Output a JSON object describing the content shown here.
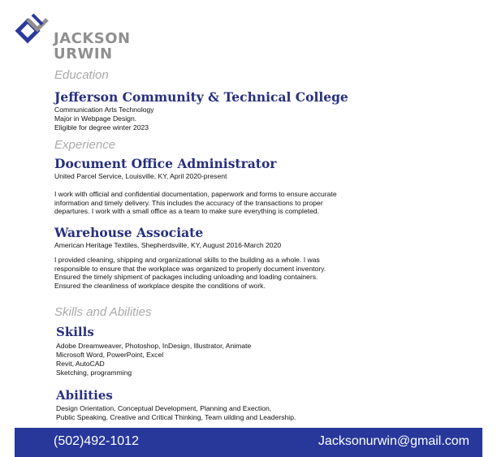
{
  "brand": {
    "line1": "JACKSON",
    "line2": "URWIN"
  },
  "education": {
    "label": "Education",
    "school": "Jefferson Community & Technical College",
    "lines": [
      "Communication Arts Technology",
      "Major in Webpage Design.",
      "Eligible for degree winter 2023"
    ]
  },
  "experience": {
    "label": "Experience",
    "jobs": [
      {
        "title": "Document Office Administrator",
        "subtitle": "United Parcel Service, Louisville, KY, April 2020-present",
        "lines": [
          "I work with official and confidential documentation, paperwork and forms to ensure accurate",
          "information and timely delivery. This includes the accuracy of the transactions to proper",
          "departures. I work with a small office as a team to make sure everything is completed."
        ]
      },
      {
        "title": "Warehouse Associate",
        "subtitle": "American Heritage Textiles, Shepherdsville, KY,  August 2016-March 2020",
        "lines": [
          "I provided cleaning, shipping and organizational skills to the building as a whole. I was",
          "responsible to ensure that the workplace was organized to properly document inventory.",
          "Ensured the timely shipment of packages including unloading and loading containers.",
          "Ensured the cleanliness of workplace despite the conditions of work."
        ]
      }
    ]
  },
  "skills_section": {
    "label": "Skills and Abilities",
    "skills_title": "Skills",
    "skills_lines": [
      "Adobe Dreamweaver, Photoshop, InDesign, Illustrator, Animate",
      "Microsoft Word, PowerPoint, Excel",
      "Revit, AutoCAD",
      "Sketching, programming"
    ],
    "abilities_title": "Abilities",
    "abilities_lines": [
      "Design Orientation, Conceptual Development, Planning and Exection,",
      "Public Speaking, Creative and Critical Thinking, Team uilding and Leadership."
    ]
  },
  "footer": {
    "phone": "(502)492-1012",
    "email": "Jacksonurwin@gmail.com"
  },
  "colors": {
    "accent": "#27307e",
    "footer_bg": "#27379a",
    "label_gray": "#a9a9a9",
    "logo_blue": "#2a3a9e",
    "logo_gray": "#8f8f8f"
  }
}
